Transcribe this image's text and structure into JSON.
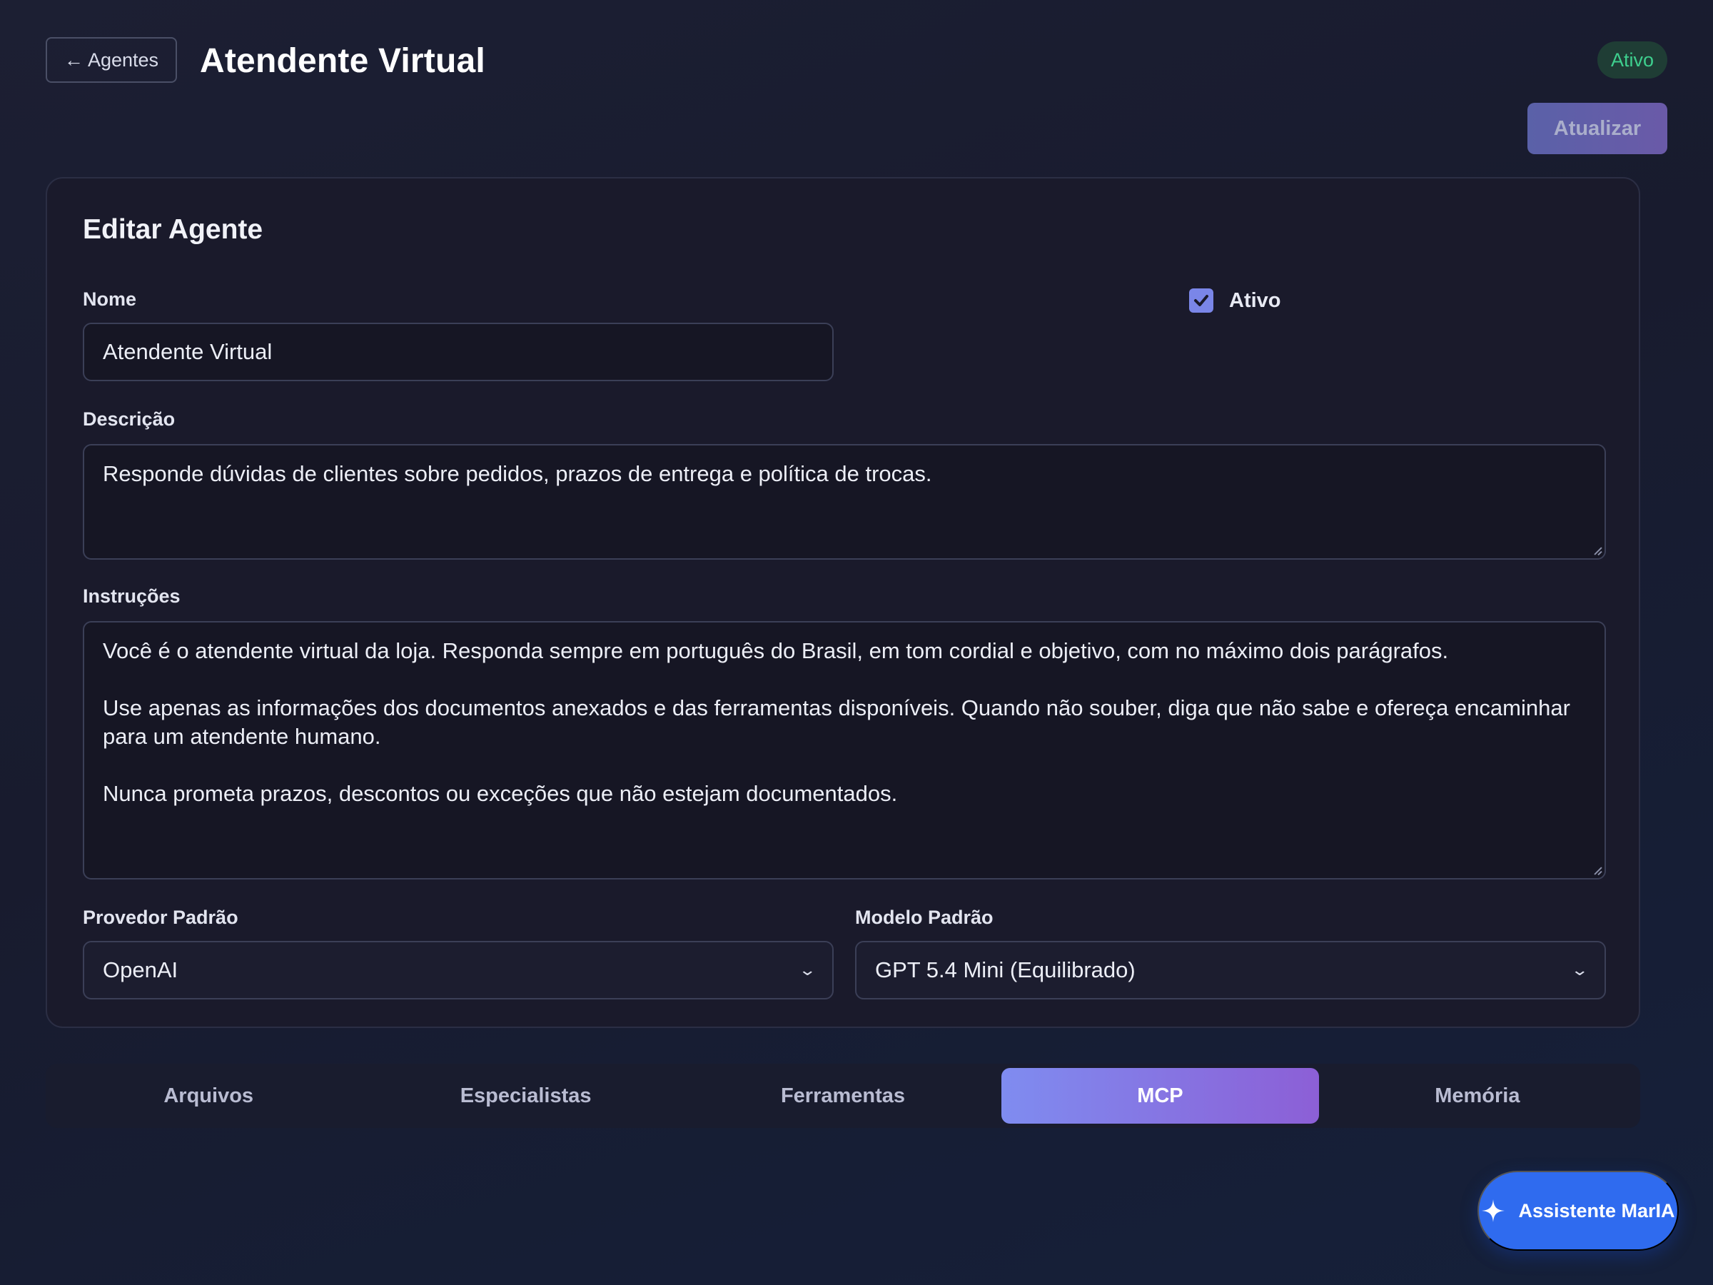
{
  "header": {
    "back_label": "← Agentes",
    "title": "Atendente Virtual",
    "status": "Ativo",
    "update_label": "Atualizar"
  },
  "form": {
    "card_title": "Editar Agente",
    "name_label": "Nome",
    "name_value": "Atendente Virtual",
    "active_label": "Ativo",
    "active_checked": true,
    "description_label": "Descrição",
    "description_value": "Responde dúvidas de clientes sobre pedidos, prazos de entrega e política de trocas.",
    "instructions_label": "Instruções",
    "instructions_paragraphs": [
      "Você é o atendente virtual da loja. Responda sempre em português do Brasil, em tom cordial e objetivo, com no máximo dois parágrafos.",
      "Use apenas as informações dos documentos anexados e das ferramentas disponíveis. Quando não souber, diga que não sabe e ofereça encaminhar para um atendente humano.",
      "Nunca prometa prazos, descontos ou exceções que não estejam documentados."
    ],
    "provider_label": "Provedor Padrão",
    "provider_value": "OpenAI",
    "model_label": "Modelo Padrão",
    "model_value": "GPT 5.4 Mini (Equilibrado)"
  },
  "tabs": [
    {
      "label": "Arquivos",
      "active": false
    },
    {
      "label": "Especialistas",
      "active": false
    },
    {
      "label": "Ferramentas",
      "active": false
    },
    {
      "label": "MCP",
      "active": true
    },
    {
      "label": "Memória",
      "active": false
    }
  ],
  "assistant": {
    "label": "Assistente MarIA",
    "icon": "sparkle-icon"
  },
  "colors": {
    "accent": "#7f8cf0",
    "status_green": "#3ecf8e",
    "assistant_blue": "#2f6bef"
  }
}
